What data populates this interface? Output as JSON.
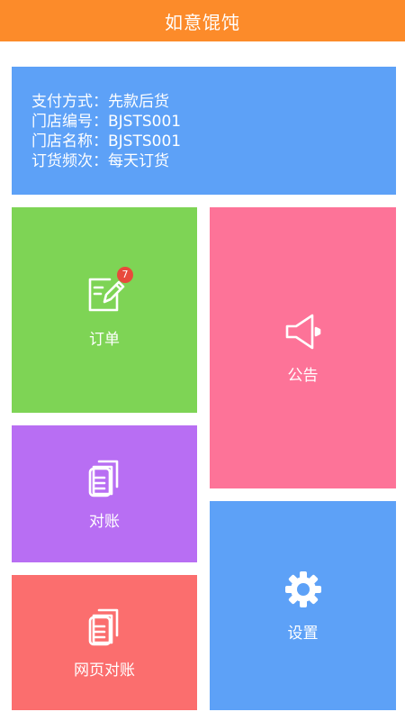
{
  "header": {
    "title": "如意馄饨"
  },
  "info": {
    "rows": [
      "支付方式：先款后货",
      "门店编号：BJSTS001",
      "门店名称：BJSTS001",
      "订货频次：每天订货"
    ]
  },
  "tiles": {
    "order": {
      "label": "订单",
      "icon": "edit-order-icon",
      "badge": "7",
      "color": "#7ed455"
    },
    "notice": {
      "label": "公告",
      "icon": "speaker-icon",
      "color": "#fd7398"
    },
    "reconcile": {
      "label": "对账",
      "icon": "documents-icon",
      "color": "#b86ef3"
    },
    "web_reconcile": {
      "label": "网页对账",
      "icon": "documents-icon",
      "color": "#fb6e6e"
    },
    "settings": {
      "label": "设置",
      "icon": "gear-icon",
      "color": "#5da1f7"
    }
  },
  "colors": {
    "header": "#fc8b2a",
    "info_card": "#5da1f7"
  }
}
